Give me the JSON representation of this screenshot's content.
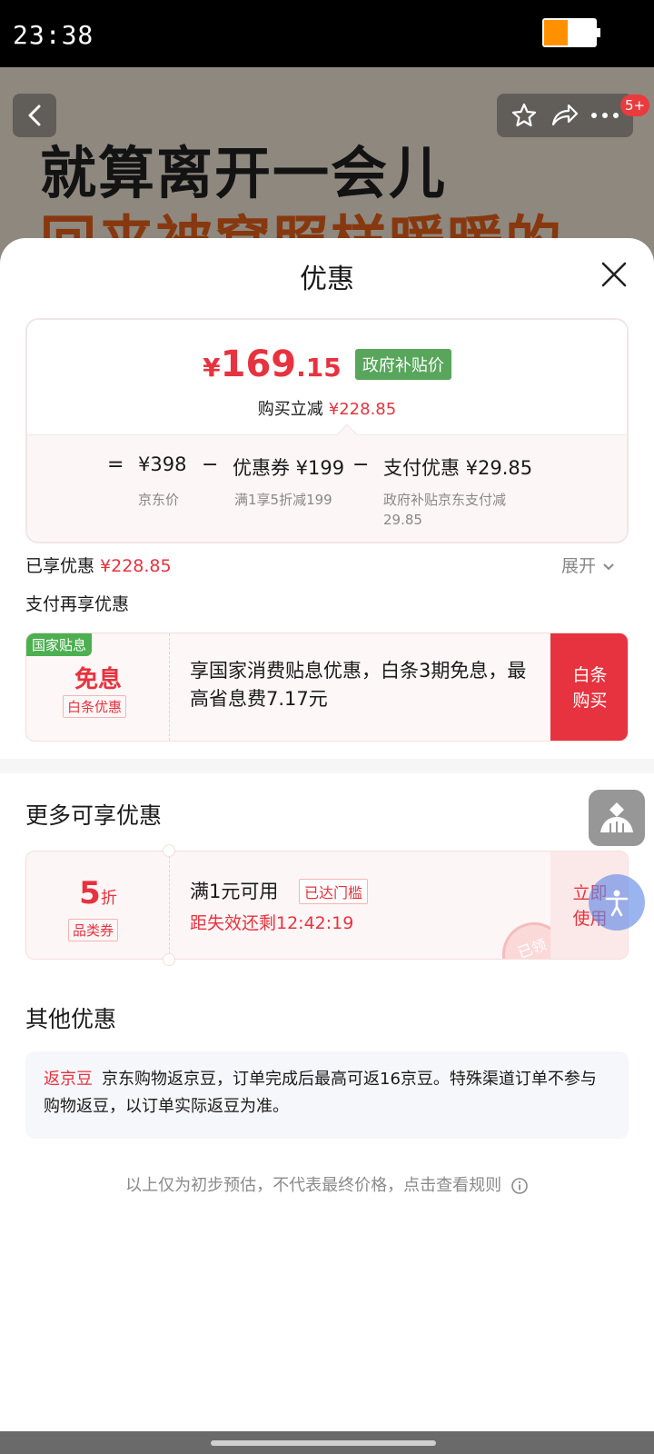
{
  "status_bar": {
    "time": "23:38"
  },
  "background": {
    "headline_line1": "就算离开一会儿",
    "headline_line2": "回来被窝照样暖暖的",
    "badge": "5+"
  },
  "sheet": {
    "title": "优惠",
    "price": {
      "yen": "¥",
      "integer": "169",
      "decimal": ".15"
    },
    "price_tag": "政府补贴价",
    "instant_label": "购买立减",
    "instant_amount": "¥228.85",
    "formula": {
      "equals": "=",
      "jd_price": "¥398",
      "jd_price_label": "京东价",
      "minus1": "−",
      "coupon": "优惠券 ¥199",
      "coupon_label": "满1享5折减199",
      "minus2": "−",
      "pay": "支付优惠 ¥29.85",
      "pay_label_line1": "政府补贴京东支付减",
      "pay_label_line2": "29.85"
    },
    "enjoyed_label": "已享优惠",
    "enjoyed_amount": "¥228.85",
    "expand_label": "展开",
    "pay_more_label": "支付再享优惠",
    "baitiao": {
      "tag": "国家贴息",
      "title": "免息",
      "sub_tag": "白条优惠",
      "desc": "享国家消费贴息优惠，白条3期免息，最高省息费7.17元",
      "button_line1": "白条",
      "button_line2": "购买"
    },
    "more_title": "更多可享优惠",
    "coupon": {
      "discount": "5",
      "discount_unit": "折",
      "category_tag": "品类券",
      "condition": "满1元可用",
      "reached_tag": "已达门槛",
      "expire": "距失效还剩12:42:19",
      "button_line1": "立即",
      "button_line2": "使用",
      "stamp": "已领"
    },
    "other_title": "其他优惠",
    "beans": {
      "label": "返京豆",
      "text": "京东购物返京豆，订单完成后最高可返16京豆。特殊渠道订单不参与购物返豆，以订单实际返豆为准。"
    },
    "footnote": "以上仅为初步预估，不代表最终价格，点击查看规则"
  },
  "colors": {
    "accent_red": "#e6333f",
    "gov_green": "#58a55c",
    "national_green": "#4caf50",
    "battery_orange": "#ff9100"
  },
  "icons": [
    "back-icon",
    "star-icon",
    "share-icon",
    "more-icon",
    "close-icon",
    "chevron-down-icon",
    "info-icon",
    "cart-float-icon",
    "accessibility-icon"
  ]
}
